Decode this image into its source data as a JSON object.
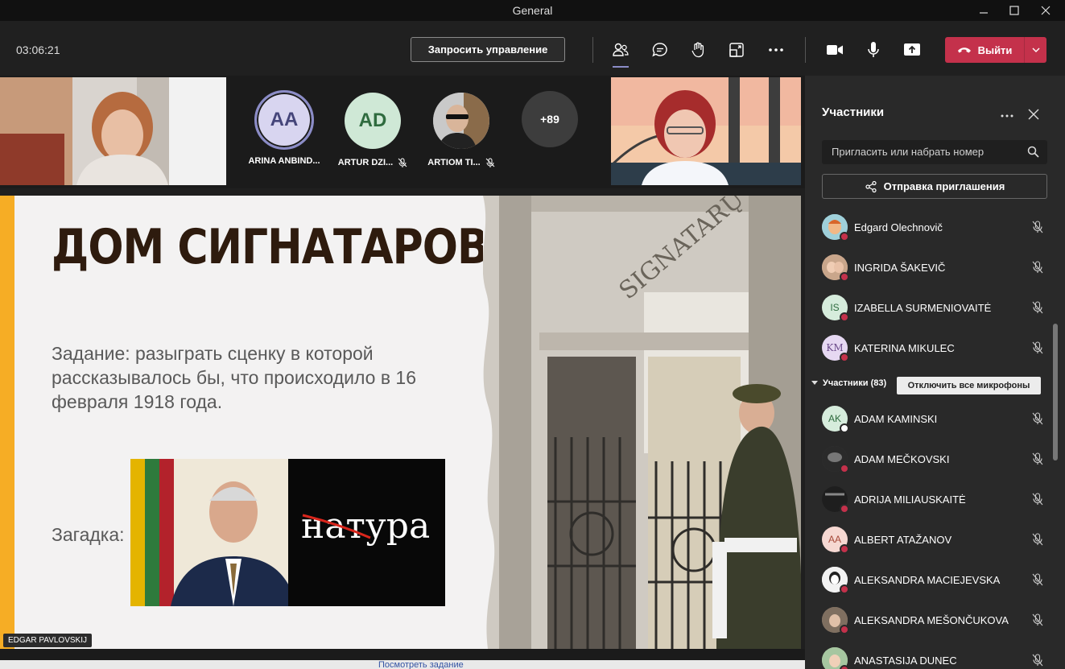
{
  "window": {
    "title": "General"
  },
  "toolbar": {
    "timer": "03:06:21",
    "request_control_label": "Запросить управление",
    "leave_label": "Выйти",
    "icons": [
      "people-icon",
      "chat-icon",
      "raise-hand-icon",
      "rooms-icon",
      "more-icon",
      "camera-icon",
      "mic-icon",
      "share-icon"
    ]
  },
  "strip": {
    "people": [
      {
        "initials": "AA",
        "name": "ARINA ANBIND...",
        "bg": "#d8d5f0",
        "fg": "#45457a",
        "ring": true,
        "muted": false
      },
      {
        "initials": "AD",
        "name": "ARTUR DZI...",
        "bg": "#cfe8d6",
        "fg": "#2f6b3f",
        "ring": false,
        "muted": true
      },
      {
        "initials": "",
        "name": "ARTIOM TI...",
        "bg": "#777",
        "fg": "#fff",
        "ring": false,
        "muted": true
      }
    ],
    "overflow": "+89"
  },
  "slide": {
    "heading": "ДОМ СИГНАТАРОВ",
    "task": "Задание: разыграть сценку в которой рассказывалось бы, что происходило в 16 февраля 1918 года.",
    "riddle_label": "Загадка:",
    "riddle_word": "натура",
    "sign_text": "SIGNATARŲ",
    "presenter": "EDGAR PAVLOVSKIJ"
  },
  "bottom": {
    "peek_text": "Посмотреть задание"
  },
  "panel": {
    "title": "Участники",
    "search_placeholder": "Пригласить или набрать номер",
    "share_label": "Отправка приглашения",
    "top_participants": [
      {
        "initials": "",
        "name": "Edgard Olechnovič",
        "bg": "#7bb9c9"
      },
      {
        "initials": "",
        "name": "INGRIDA ŠAKEVIČ",
        "bg": "#c9a68b"
      },
      {
        "initials": "IS",
        "name": "IZABELLA SURMENIOVAITĖ",
        "bg": "#d6ecdc"
      },
      {
        "initials": "KM",
        "name": "KATERINA MIKULEC",
        "bg": "#e6d8f2"
      }
    ],
    "section_label": "Участники (83)",
    "mute_all_label": "Отключить все микрофоны",
    "participants": [
      {
        "initials": "AK",
        "name": "ADAM KAMINSKI",
        "bg": "#d6ecdc",
        "ok": true
      },
      {
        "initials": "",
        "name": "ADAM MEČKOVSKI",
        "bg": "#444",
        "ok": false
      },
      {
        "initials": "",
        "name": "ADRIJA MILIAUSKAITĖ",
        "bg": "#333",
        "ok": false
      },
      {
        "initials": "AA",
        "name": "ALBERT ATAŽANOV",
        "bg": "#f6d8d2",
        "ok": false
      },
      {
        "initials": "",
        "name": "ALEKSANDRA MACIEJEVSKA",
        "bg": "#eee",
        "ok": false
      },
      {
        "initials": "",
        "name": "ALEKSANDRA MEŠONČUKOVA",
        "bg": "#9b8a7a",
        "ok": false
      },
      {
        "initials": "",
        "name": "ANASTASIJA DUNEC",
        "bg": "#a6c6a0",
        "ok": false
      }
    ]
  }
}
